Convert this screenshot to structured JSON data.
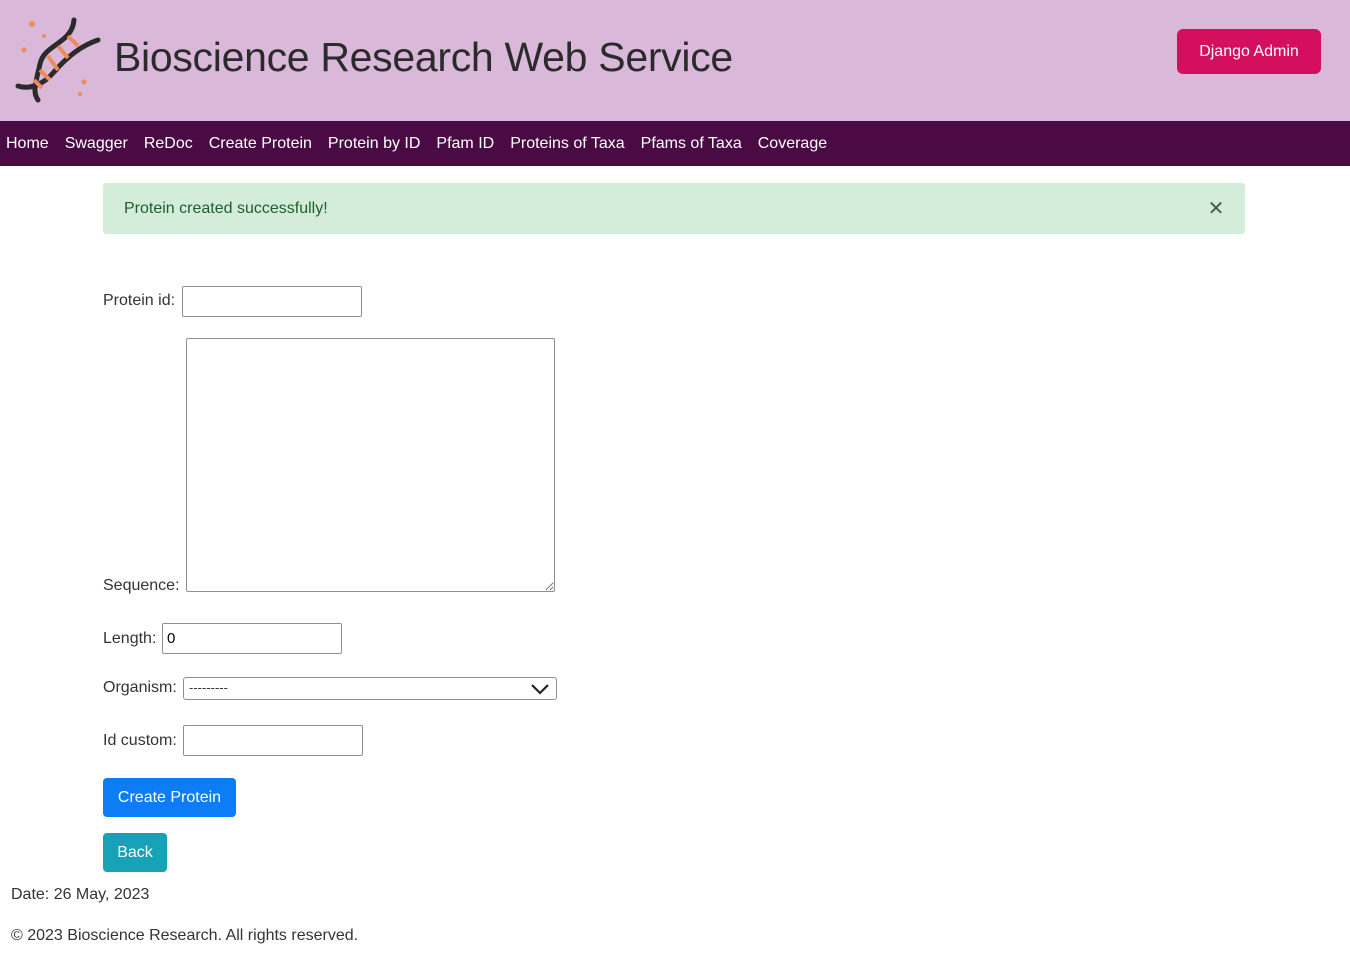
{
  "header": {
    "title": "Bioscience Research Web Service",
    "admin_button": "Django Admin"
  },
  "nav": {
    "items": [
      "Home",
      "Swagger",
      "ReDoc",
      "Create Protein",
      "Protein by ID",
      "Pfam ID",
      "Proteins of Taxa",
      "Pfams of Taxa",
      "Coverage"
    ]
  },
  "alert": {
    "message": "Protein created successfully!",
    "close_icon": "close-icon"
  },
  "form": {
    "protein_id_label": "Protein id:",
    "protein_id_value": "",
    "sequence_label": "Sequence:",
    "sequence_value": "",
    "length_label": "Length:",
    "length_value": "0",
    "organism_label": "Organism:",
    "organism_selected": "---------",
    "id_custom_label": "Id custom:",
    "id_custom_value": "",
    "submit_label": "Create Protein",
    "back_label": "Back"
  },
  "footer": {
    "date": "Date: 26 May, 2023",
    "copyright": "© 2023 Bioscience Research. All rights reserved."
  },
  "colors": {
    "header_bg": "#d9b8d9",
    "nav_bg": "#4a0b45",
    "admin_button": "#d30f5e",
    "alert_bg": "#d4eddb",
    "primary_button": "#0d7cf7",
    "info_button": "#17a2b8"
  }
}
